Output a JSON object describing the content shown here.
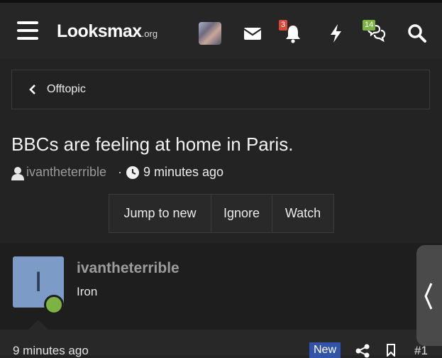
{
  "header": {
    "logo_main": "Looksmax",
    "logo_sub": ".org",
    "notifications_badge": "3",
    "conversations_badge": "14",
    "notifications_badge_color": "#d9473a",
    "conversations_badge_color": "#7cb342"
  },
  "breadcrumb": {
    "label": "Offtopic"
  },
  "thread": {
    "title": "BBCs are feeling at home in Paris.",
    "author": "ivantheterrible",
    "separator": "·",
    "time": "9 minutes ago"
  },
  "actions": [
    {
      "label": "Jump to new"
    },
    {
      "label": "Ignore"
    },
    {
      "label": "Watch"
    }
  ],
  "post": {
    "avatar_letter": "I",
    "username": "ivantheterrible",
    "user_title": "Iron",
    "time": "9 minutes ago",
    "new_label": "New",
    "number": "#1",
    "avatar_color": "#7d9bc7",
    "online_color": "#7cb342"
  },
  "icons": {
    "menu": "hamburger-icon",
    "messages": "envelope-icon",
    "alerts": "bell-icon",
    "whats_new": "bolt-icon",
    "conversations": "chat-bubbles-icon",
    "search": "search-icon",
    "share": "share-icon",
    "bookmark": "bookmark-icon",
    "side": "chevron-left-icon"
  }
}
